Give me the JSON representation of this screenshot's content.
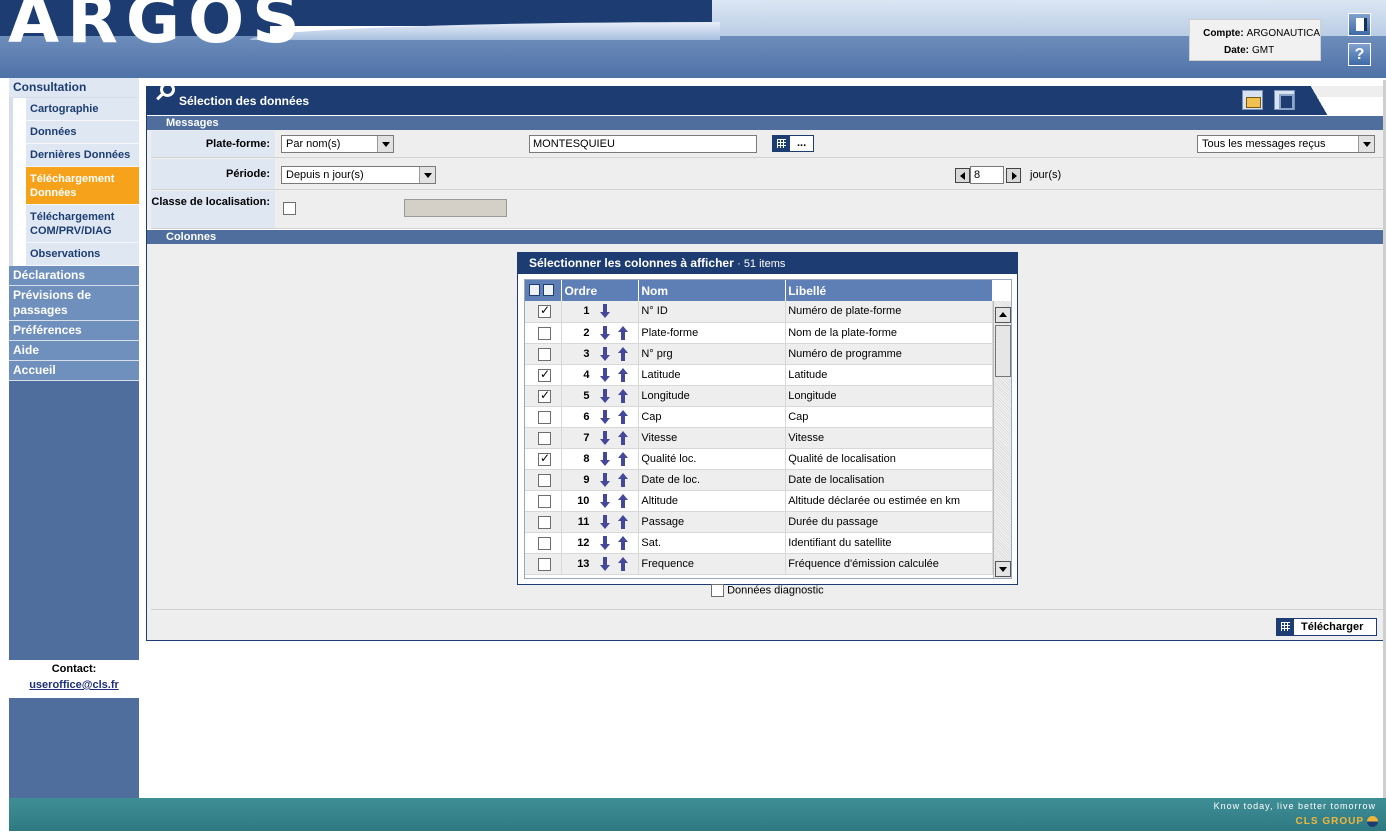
{
  "header": {
    "logo": "ARGOS",
    "account_label": "Compte:",
    "account_value": "ARGONAUTICA",
    "date_label": "Date:",
    "date_value": "GMT",
    "help_symbol": "?"
  },
  "sidebar": {
    "consultation": "Consultation",
    "sub_items": [
      {
        "label": "Cartographie"
      },
      {
        "label": "Données"
      },
      {
        "label": "Dernières Données"
      },
      {
        "label": "Téléchargement Données"
      },
      {
        "label": "Téléchargement COM/PRV/DIAG"
      },
      {
        "label": "Observations"
      }
    ],
    "sections": [
      {
        "label": "Déclarations"
      },
      {
        "label": "Prévisions de passages"
      },
      {
        "label": "Préférences"
      },
      {
        "label": "Aide"
      },
      {
        "label": "Accueil"
      }
    ],
    "contact_label": "Contact:",
    "contact_email": "useroffice@cls.fr"
  },
  "main": {
    "title": "Sélection des données",
    "messages_section": "Messages",
    "platform_label": "Plate-forme:",
    "platform_mode": "Par nom(s)",
    "platform_value": "MONTESQUIEU",
    "platform_btn_label": "...",
    "messages_filter": "Tous les messages reçus",
    "period_label": "Période:",
    "period_mode": "Depuis n jour(s)",
    "period_value": "8",
    "period_unit": "jour(s)",
    "class_label": "Classe de localisation:",
    "columns_section": "Colonnes",
    "column_panel_title": "Sélectionner les colonnes à afficher",
    "column_panel_count": "· 51 items",
    "table_headers": {
      "order": "Ordre",
      "name": "Nom",
      "label": "Libellé"
    },
    "rows": [
      {
        "checked": true,
        "order": "1",
        "name": "N° ID",
        "label": "Numéro de plate-forme"
      },
      {
        "checked": false,
        "order": "2",
        "name": "Plate-forme",
        "label": "Nom de la plate-forme"
      },
      {
        "checked": false,
        "order": "3",
        "name": "N° prg",
        "label": "Numéro de programme"
      },
      {
        "checked": true,
        "order": "4",
        "name": "Latitude",
        "label": "Latitude"
      },
      {
        "checked": true,
        "order": "5",
        "name": "Longitude",
        "label": "Longitude"
      },
      {
        "checked": false,
        "order": "6",
        "name": "Cap",
        "label": "Cap"
      },
      {
        "checked": false,
        "order": "7",
        "name": "Vitesse",
        "label": "Vitesse"
      },
      {
        "checked": true,
        "order": "8",
        "name": "Qualité loc.",
        "label": "Qualité de localisation"
      },
      {
        "checked": false,
        "order": "9",
        "name": "Date de loc.",
        "label": "Date de localisation"
      },
      {
        "checked": false,
        "order": "10",
        "name": "Altitude",
        "label": "Altitude déclarée ou estimée en km"
      },
      {
        "checked": false,
        "order": "11",
        "name": "Passage",
        "label": "Durée du passage"
      },
      {
        "checked": false,
        "order": "12",
        "name": "Sat.",
        "label": "Identifiant du satellite"
      },
      {
        "checked": false,
        "order": "13",
        "name": "Frequence",
        "label": "Fréquence d'émission calculée"
      }
    ],
    "diagnostic_label": "Données diagnostic",
    "download_label": "Télécharger"
  },
  "footer": {
    "slogan": "Know today, live better tomorrow",
    "brand": "CLS GROUP"
  }
}
